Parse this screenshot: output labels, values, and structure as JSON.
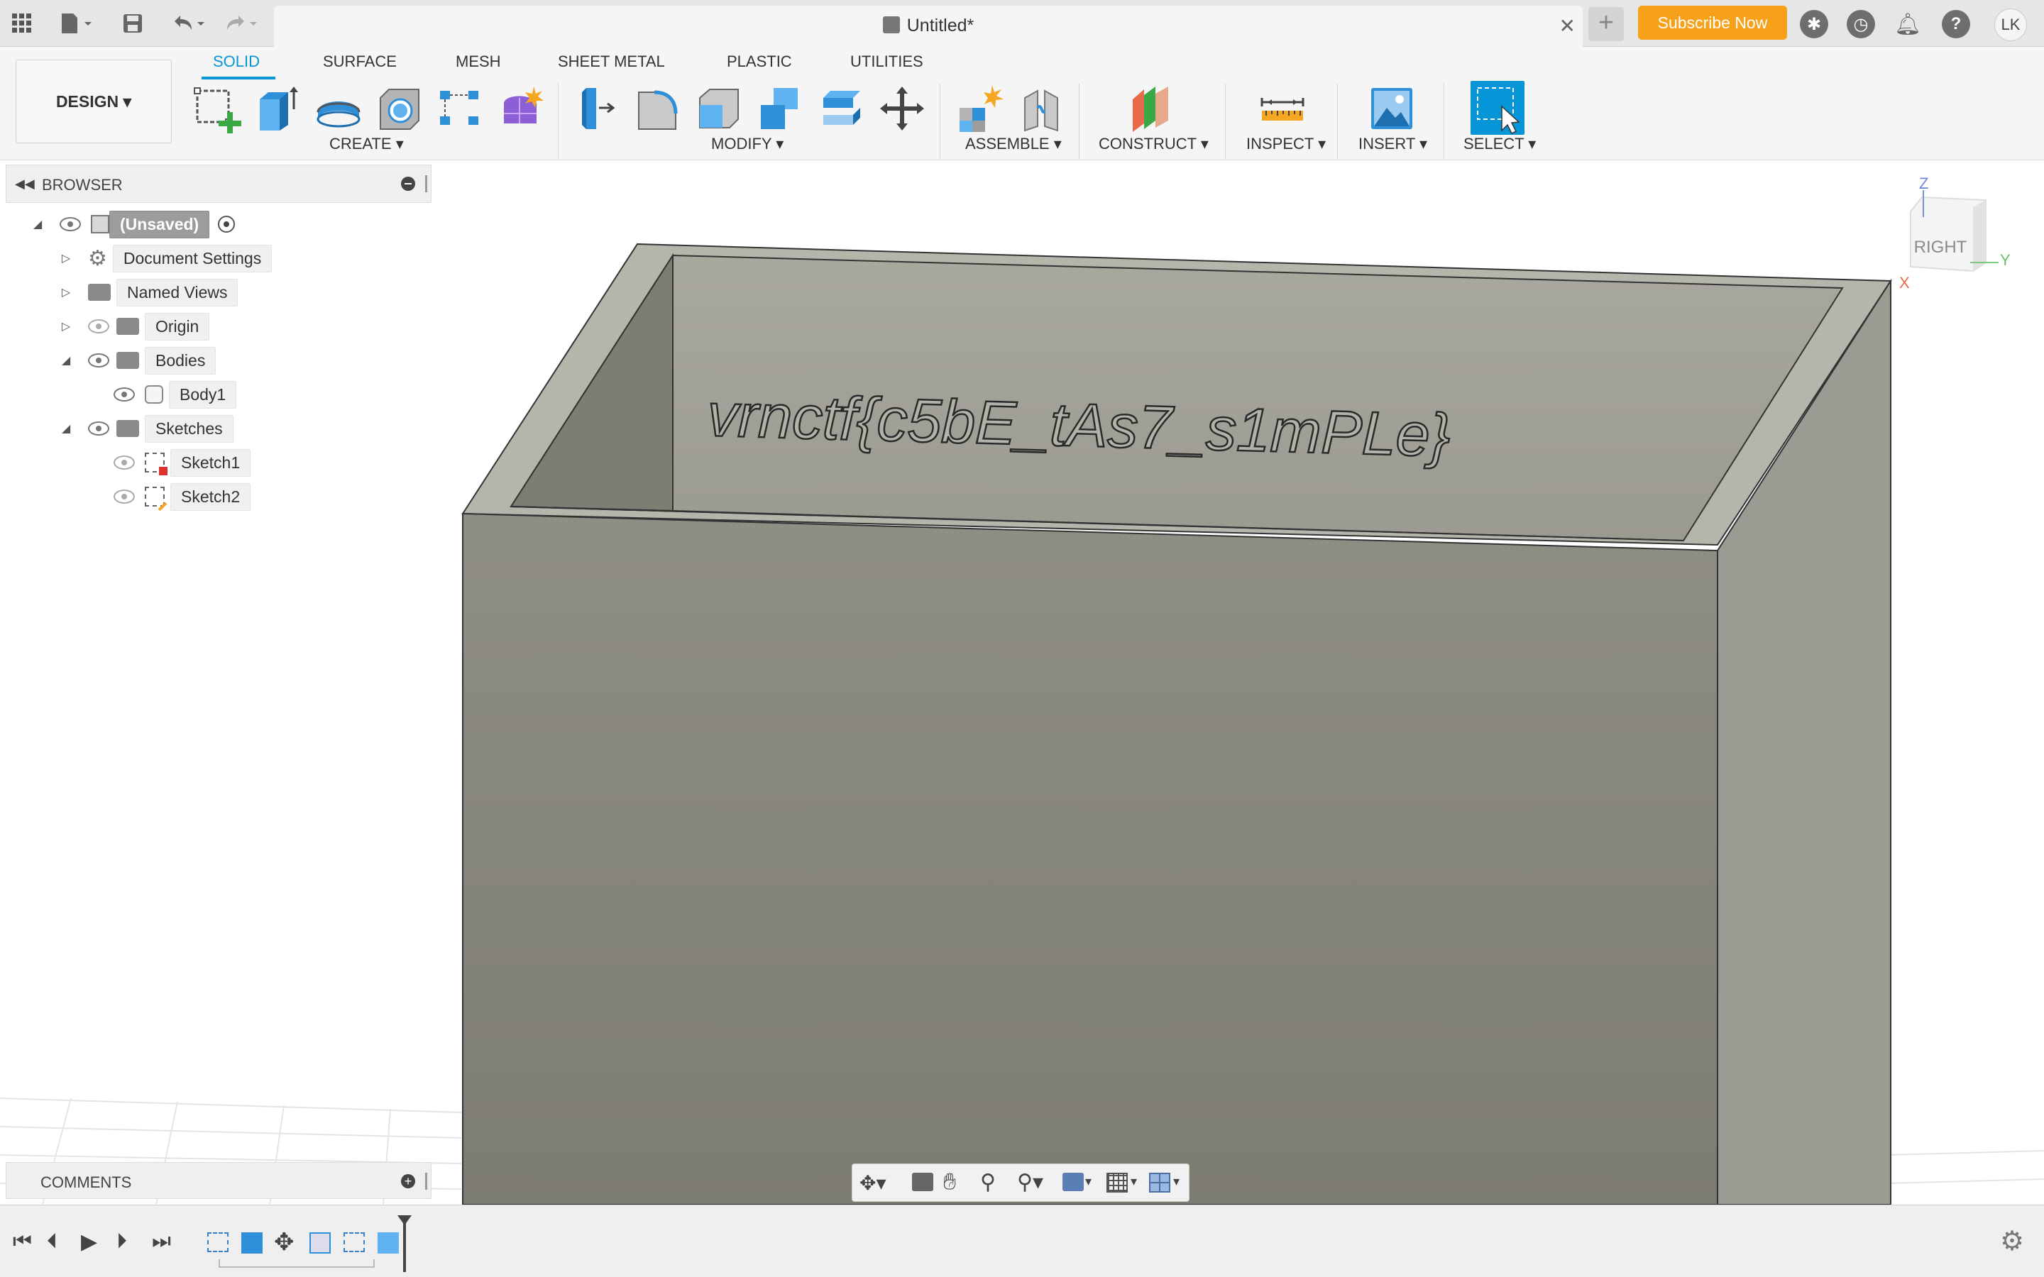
{
  "titlebar": {
    "doc_title": "Untitled*",
    "subscribe_label": "Subscribe Now",
    "avatar_initials": "LK"
  },
  "toolbar": {
    "workspace_label": "DESIGN ▾",
    "tabs": [
      {
        "label": "SOLID",
        "active": true
      },
      {
        "label": "SURFACE"
      },
      {
        "label": "MESH"
      },
      {
        "label": "SHEET METAL"
      },
      {
        "label": "PLASTIC"
      },
      {
        "label": "UTILITIES"
      }
    ],
    "groups": {
      "create": "CREATE ▾",
      "modify": "MODIFY ▾",
      "assemble": "ASSEMBLE ▾",
      "construct": "CONSTRUCT ▾",
      "inspect": "INSPECT ▾",
      "insert": "INSERT ▾",
      "select": "SELECT ▾"
    }
  },
  "browser": {
    "title": "BROWSER",
    "items": [
      {
        "label": "(Unsaved)"
      },
      {
        "label": "Document Settings"
      },
      {
        "label": "Named Views"
      },
      {
        "label": "Origin"
      },
      {
        "label": "Bodies"
      },
      {
        "label": "Body1"
      },
      {
        "label": "Sketches"
      },
      {
        "label": "Sketch1"
      },
      {
        "label": "Sketch2"
      }
    ]
  },
  "comments": {
    "title": "COMMENTS"
  },
  "viewport": {
    "engraved_text": "vrnctf{c5bE_tAs7_s1mPLe}",
    "viewcube_face": "RIGHT",
    "axis_z": "Z",
    "axis_y": "Y",
    "axis_x": "X"
  },
  "colors": {
    "accent": "#0696d7",
    "subscribe": "#f7a11a",
    "model": "#8a897f"
  }
}
